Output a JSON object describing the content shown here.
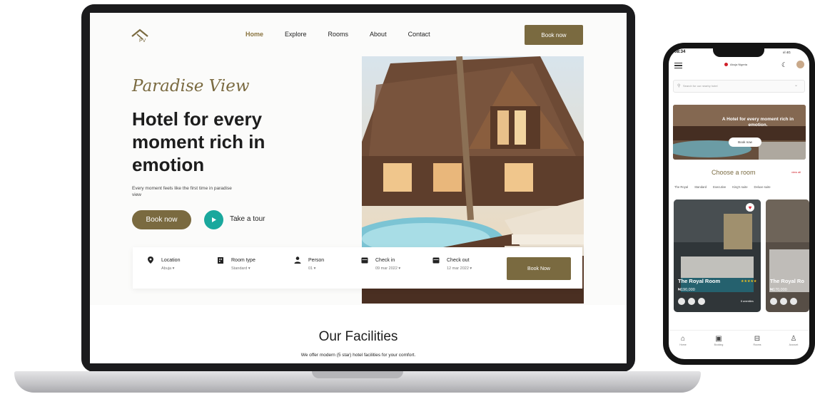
{
  "desktop": {
    "nav": [
      "Home",
      "Explore",
      "Rooms",
      "About",
      "Contact"
    ],
    "book_now": "Book now",
    "script_title": "Paradise View",
    "headline": "Hotel for every moment rich in emotion",
    "subtext": "Every moment feels like the first time in paradise view",
    "hero_book": "Book now",
    "tour_label": "Take a tour",
    "booking": [
      {
        "label": "Location",
        "value": "Abuja ▾",
        "icon": "location-pin-icon"
      },
      {
        "label": "Room type",
        "value": "Standard ▾",
        "icon": "building-icon"
      },
      {
        "label": "Person",
        "value": "01 ▾",
        "icon": "person-icon"
      },
      {
        "label": "Check in",
        "value": "09 mar 2022 ▾",
        "icon": "calendar-icon"
      },
      {
        "label": "Check out",
        "value": "12 mar 2022 ▾",
        "icon": "calendar-icon"
      }
    ],
    "booking_submit": "Book Now",
    "facilities_title": "Our Facilities",
    "facilities_sub": "We offer modern (5 star) hotel facilities for your comfort."
  },
  "mobile": {
    "time": "08:34",
    "signal": "ııl 4G",
    "location": "Abuja Nigeria",
    "search_placeholder": "Search for our nearby hotel",
    "banner_text": "A Hotel for every moment rich in emotion.",
    "banner_button": "Book now",
    "choose_title": "Choose a room",
    "view_all": "view all",
    "tabs": [
      "The Royal",
      "Standard",
      "Executive",
      "King's suite",
      "Deluxe suite"
    ],
    "cards": [
      {
        "name": "The Royal Room",
        "price": "₦190,000",
        "stars": "★★★★★",
        "amenities": "8 amenities"
      },
      {
        "name": "The Royal Ro",
        "price": "₦170,000"
      }
    ],
    "bottom_nav": [
      "Home",
      "Booking",
      "Rooms",
      "Account"
    ]
  },
  "colors": {
    "brand": "#7a6a40",
    "teal": "#1aa89d",
    "accent_red": "#d0202a"
  }
}
